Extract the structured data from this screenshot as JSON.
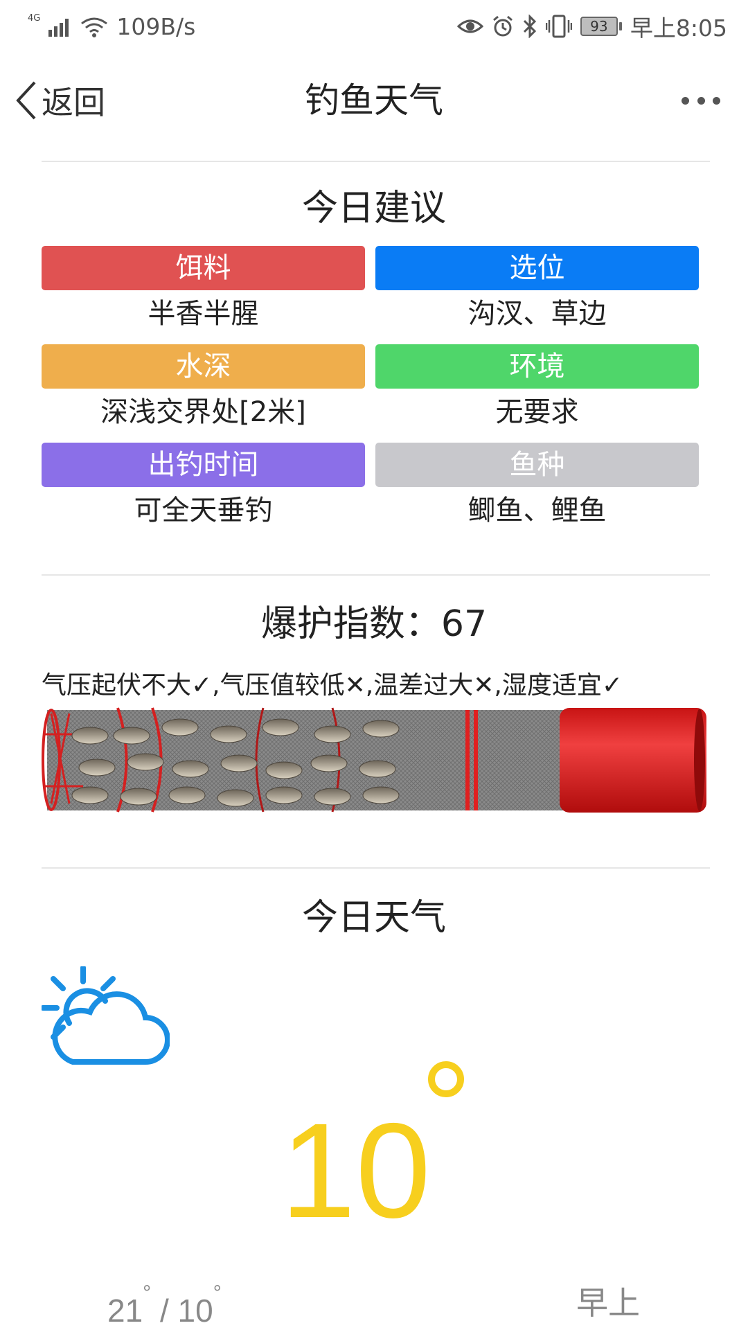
{
  "status_bar": {
    "network_type": "4G",
    "speed": "109B/s",
    "battery": "93",
    "time": "早上8:05"
  },
  "nav": {
    "back_label": "返回",
    "title": "钓鱼天气"
  },
  "advice": {
    "title": "今日建议",
    "items": [
      {
        "label": "饵料",
        "value": "半香半腥",
        "color": "#e05252"
      },
      {
        "label": "选位",
        "value": "沟汊、草边",
        "color": "#0a7cf5"
      },
      {
        "label": "水深",
        "value": "深浅交界处[2米]",
        "color": "#efae4c"
      },
      {
        "label": "环境",
        "value": "无要求",
        "color": "#4fd66a"
      },
      {
        "label": "出钓时间",
        "value": "可全天垂钓",
        "color": "#8b6fe8"
      },
      {
        "label": "鱼种",
        "value": "鲫鱼、鲤鱼",
        "color": "#c8c8cc"
      }
    ]
  },
  "index": {
    "title": "爆护指数：67",
    "value": 67,
    "factors": "气压起伏不大✓,气压值较低✕,温差过大✕,湿度适宜✓"
  },
  "weather": {
    "title": "今日天气",
    "icon": "partly-cloudy-icon",
    "temperature": "10",
    "high": "21",
    "low": "10",
    "range_separator": "/",
    "period": "早上",
    "accent_color": "#f7cf1e",
    "icon_color": "#1a8fe3"
  }
}
